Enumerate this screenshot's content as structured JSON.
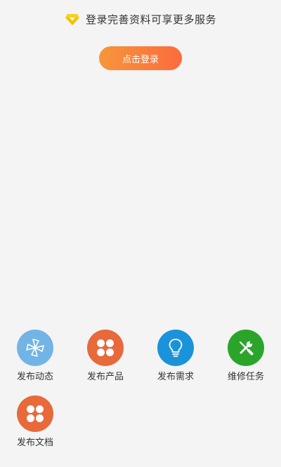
{
  "promo": {
    "text": "登录完善资料可享更多服务",
    "icon": "diamond-icon",
    "icon_color": "#f5d31a"
  },
  "login_button": {
    "label": "点击登录",
    "gradient_start": "#f7963a",
    "gradient_end": "#fb6b3e"
  },
  "actions": [
    {
      "label": "发布动态",
      "icon": "pinwheel-icon",
      "color": "#72b4e6"
    },
    {
      "label": "发布产品",
      "icon": "four-petal-icon",
      "color": "#e8693a"
    },
    {
      "label": "发布需求",
      "icon": "lightbulb-icon",
      "color": "#1b93da"
    },
    {
      "label": "维修任务",
      "icon": "tools-icon",
      "color": "#2aa52a"
    },
    {
      "label": "发布文档",
      "icon": "four-petal-icon",
      "color": "#e8693a"
    }
  ]
}
